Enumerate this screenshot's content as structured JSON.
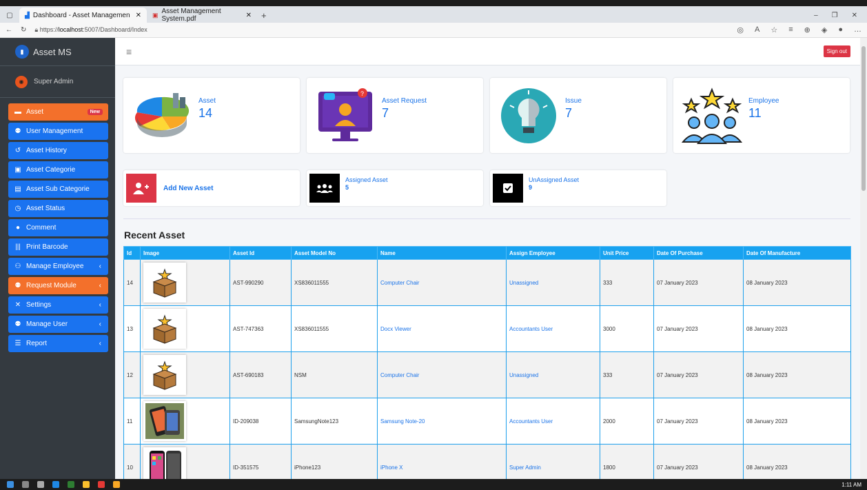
{
  "browser": {
    "tabs": [
      {
        "title": "Dashboard - Asset Managemen",
        "active": true
      },
      {
        "title": "Asset Management System.pdf",
        "active": false
      }
    ],
    "url_prefix": "https://",
    "url_host": "localhost",
    "url_path": ":5007/Dashboard/Index"
  },
  "sidebar": {
    "brand": "Asset MS",
    "user": "Super Admin",
    "items": [
      {
        "label": "Asset",
        "icon": "box-icon",
        "color": "#f3702b",
        "badge": "New"
      },
      {
        "label": "User Management",
        "icon": "users-icon",
        "color": "#1a73f0"
      },
      {
        "label": "Asset History",
        "icon": "history-icon",
        "color": "#1a73f0"
      },
      {
        "label": "Asset Categorie",
        "icon": "category-icon",
        "color": "#1a73f0"
      },
      {
        "label": "Asset Sub Categorie",
        "icon": "subcategory-icon",
        "color": "#1a73f0"
      },
      {
        "label": "Asset Status",
        "icon": "status-icon",
        "color": "#1a73f0"
      },
      {
        "label": "Comment",
        "icon": "comment-icon",
        "color": "#1a73f0"
      },
      {
        "label": "Print Barcode",
        "icon": "barcode-icon",
        "color": "#1a73f0"
      },
      {
        "label": "Manage Employee",
        "icon": "employees-icon",
        "color": "#1a73f0",
        "chevron": true
      },
      {
        "label": "Request Module",
        "icon": "request-icon",
        "color": "#f3702b",
        "chevron": true
      },
      {
        "label": "Settings",
        "icon": "settings-icon",
        "color": "#1a73f0",
        "chevron": true
      },
      {
        "label": "Manage User",
        "icon": "user-manage-icon",
        "color": "#1a73f0",
        "chevron": true
      },
      {
        "label": "Report",
        "icon": "report-icon",
        "color": "#1a73f0",
        "chevron": true
      }
    ]
  },
  "header": {
    "signout_label": "Sign out"
  },
  "stats": [
    {
      "label": "Asset",
      "value": "14",
      "icon": "pie-chart-icon"
    },
    {
      "label": "Asset Request",
      "value": "7",
      "icon": "asset-request-icon"
    },
    {
      "label": "Issue",
      "value": "7",
      "icon": "lightbulb-icon"
    },
    {
      "label": "Employee",
      "value": "11",
      "icon": "employees-stars-icon"
    }
  ],
  "actions": {
    "add_label": "Add New Asset",
    "assigned_label": "Assigned Asset",
    "assigned_value": "5",
    "unassigned_label": "UnAssigned Asset",
    "unassigned_value": "9"
  },
  "recent": {
    "title": "Recent Asset",
    "columns": [
      "Id",
      "Image",
      "Asset Id",
      "Asset Model No",
      "Name",
      "Assign Employee",
      "Unit Price",
      "Date Of Purchase",
      "Date Of Manufacture"
    ],
    "rows": [
      {
        "id": "14",
        "image": "box-icon",
        "asset_id": "AST-990290",
        "model": "XS836011555",
        "name": "Computer Chair",
        "employee": "Unassigned",
        "price": "333",
        "purchase": "07 January 2023",
        "manufacture": "08 January 2023"
      },
      {
        "id": "13",
        "image": "box-icon",
        "asset_id": "AST-747363",
        "model": "XS836011555",
        "name": "Docx Viewer",
        "employee": "Accountants User",
        "price": "3000",
        "purchase": "07 January 2023",
        "manufacture": "08 January 2023"
      },
      {
        "id": "12",
        "image": "box-icon",
        "asset_id": "AST-690183",
        "model": "NSM",
        "name": "Computer Chair",
        "employee": "Unassigned",
        "price": "333",
        "purchase": "07 January 2023",
        "manufacture": "08 January 2023"
      },
      {
        "id": "11",
        "image": "phone-photo",
        "asset_id": "ID-209038",
        "model": "SamsungNote123",
        "name": "Samsung Note-20",
        "employee": "Accountants User",
        "price": "2000",
        "purchase": "07 January 2023",
        "manufacture": "08 January 2023"
      },
      {
        "id": "10",
        "image": "iphone-photo",
        "asset_id": "ID-351575",
        "model": "iPhone123",
        "name": "iPhone X",
        "employee": "Super Admin",
        "price": "1800",
        "purchase": "07 January 2023",
        "manufacture": "08 January 2023"
      }
    ]
  },
  "taskbar": {
    "clock": "1:11 AM"
  }
}
